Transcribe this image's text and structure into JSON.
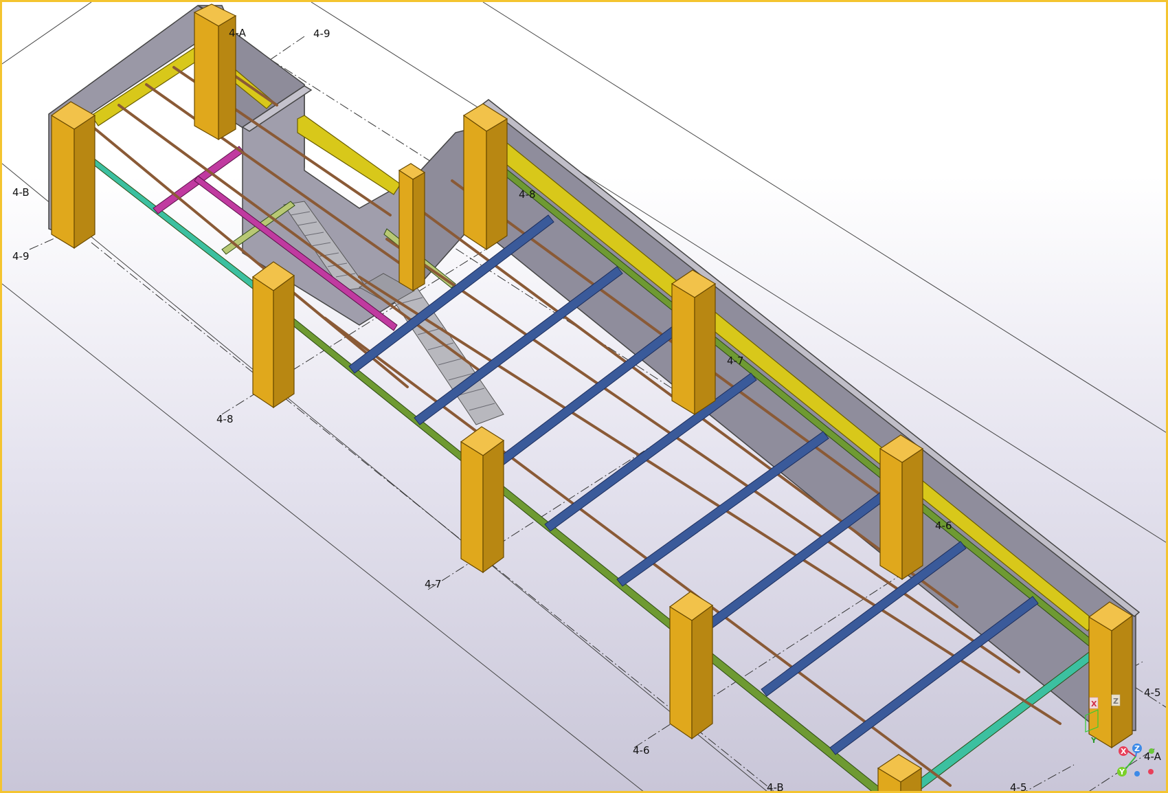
{
  "grid_labels": {
    "a_top": "4-A",
    "nine_top": "4-9",
    "b_left": "4-B",
    "nine_left": "4-9",
    "eight_top": "4-8",
    "seven_top": "4-7",
    "six_top": "4-6",
    "eight_bottom": "4-8",
    "seven_bottom": "4-7",
    "six_bottom": "4-6",
    "five_right": "4-5",
    "a_right": "4-A",
    "b_bottom": "4-B",
    "five_bottom": "4-5"
  },
  "axis_gizmo": {
    "x": "X",
    "y": "Y",
    "z": "Z"
  },
  "colors": {
    "frame": "#f4c430",
    "wall": "#9a98a6",
    "column": "#e0a81c",
    "yellow_beam": "#d8c81a",
    "green_beam": "#6e9a32",
    "teal_beam": "#3cc0a0",
    "blue_beam": "#3a5a9a",
    "brown_joist": "#8a5a36",
    "magenta_beam": "#c03aa0",
    "stair": "#8a8a90"
  }
}
